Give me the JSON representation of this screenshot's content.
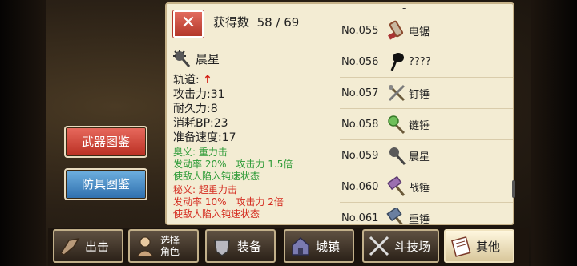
{
  "side_buttons": {
    "weapons": "武器图鉴",
    "armor": "防具图鉴"
  },
  "panel": {
    "close_glyph": "✕",
    "collected_label": "获得数",
    "collected_value": "58 / 69",
    "selected": {
      "name": "晨星",
      "icon": "morning-star-icon",
      "stats": [
        {
          "label": "轨道:",
          "value": "↑",
          "kind": "arrow"
        },
        {
          "label": "攻击力:",
          "value": "31"
        },
        {
          "label": "耐久力:",
          "value": "8"
        },
        {
          "label": "消耗BP:",
          "value": "23"
        },
        {
          "label": "准备速度:",
          "value": "17"
        }
      ],
      "skill1": {
        "title": "奥义: 重力击",
        "line1": "发动率 20%　攻击力 1.5倍",
        "line2": "使敌人陷入钝速状态"
      },
      "skill2": {
        "title": "秘义: 超重力击",
        "line1": "发动率 10%　攻击力 2倍",
        "line2": "使敌人陷入钝速状态"
      }
    },
    "list_top_mark": "-",
    "list": [
      {
        "no": "No.055",
        "name": "电锯",
        "icon": "chainsaw-icon"
      },
      {
        "no": "No.056",
        "name": "????",
        "icon": "unknown-silhouette-icon"
      },
      {
        "no": "No.057",
        "name": "钉锤",
        "icon": "spiked-mace-icon"
      },
      {
        "no": "No.058",
        "name": "链锤",
        "icon": "flail-icon"
      },
      {
        "no": "No.059",
        "name": "晨星",
        "icon": "morning-star-icon"
      },
      {
        "no": "No.060",
        "name": "战锤",
        "icon": "war-hammer-icon"
      },
      {
        "no": "No.061",
        "name": "重锤",
        "icon": "heavy-hammer-icon"
      }
    ]
  },
  "nav": {
    "items": [
      {
        "label": "出击",
        "icon": "sortie-icon"
      },
      {
        "label": "选择\n角色",
        "icon": "character-select-icon"
      },
      {
        "label": "装备",
        "icon": "equipment-icon"
      },
      {
        "label": "城镇",
        "icon": "town-icon"
      },
      {
        "label": "斗技场",
        "icon": "arena-swords-icon"
      },
      {
        "label": "其他",
        "icon": "other-notes-icon",
        "active": true
      }
    ]
  }
}
